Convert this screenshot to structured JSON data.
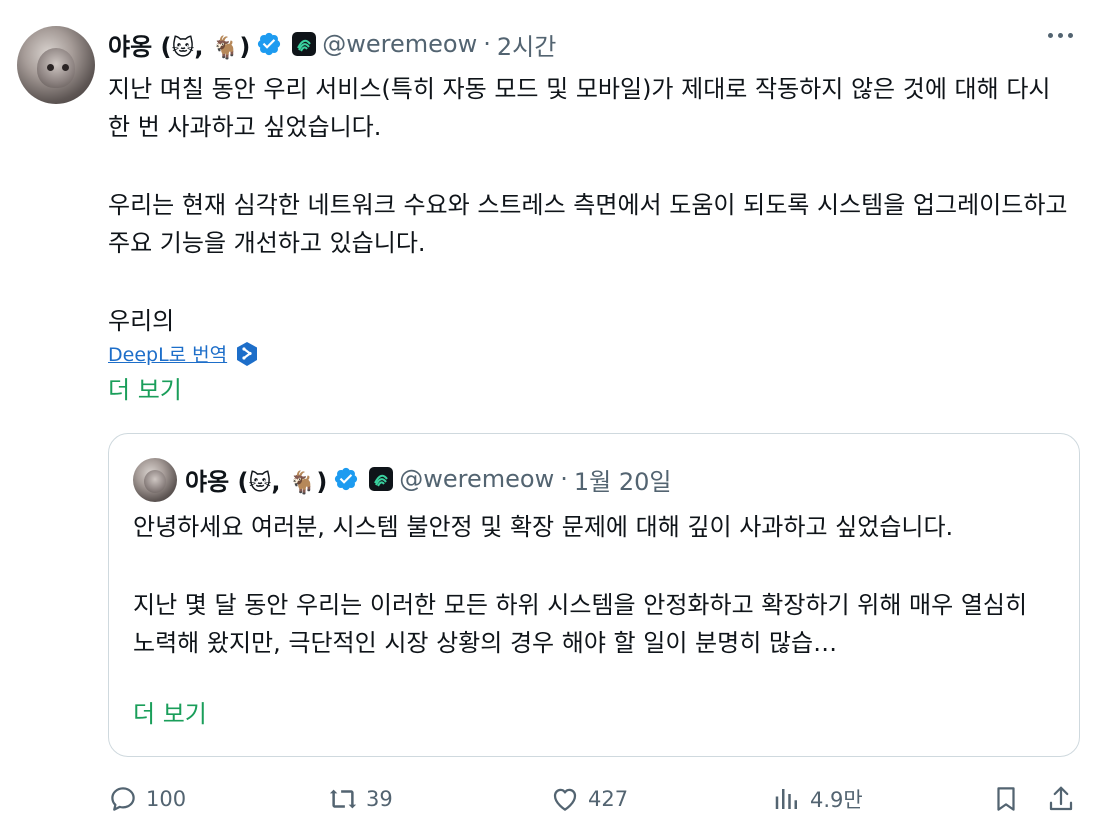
{
  "tweet": {
    "author_name": "야옹 (",
    "emoji_cat": "🐱",
    "comma": ",",
    "emoji_goat": "🐐",
    "paren_close": ")",
    "handle": "@weremeow",
    "separator": "·",
    "time": "2시간",
    "paragraphs": [
      "지난 며칠 동안 우리 서비스(특히 자동 모드 및 모바일)가 제대로 작동하지 않은 것에 대해 다시 한 번 사과하고 싶었습니다.",
      "우리는 현재 심각한 네트워크 수요와 스트레스 측면에서 도움이 되도록 시스템을 업그레이드하고 주요 기능을 개선하고 있습니다.",
      "우리의"
    ],
    "translate_label": "DeepL로 번역",
    "show_more": "더 보기"
  },
  "quoted": {
    "author_name": "야옹 (",
    "emoji_cat": "🐱",
    "comma": ",",
    "emoji_goat": "🐐",
    "paren_close": ")",
    "handle": "@weremeow",
    "separator": "·",
    "date": "1월 20일",
    "paragraphs": [
      "안녕하세요 여러분, 시스템 불안정 및 확장 문제에 대해 깊이 사과하고 싶었습니다.",
      "지난 몇 달 동안 우리는 이러한 모든 하위 시스템을 안정화하고 확장하기 위해 매우 열심히 노력해 왔지만, 극단적인 시장 상황의 경우 해야 할 일이 분명히 많습…"
    ],
    "show_more": "더 보기"
  },
  "actions": {
    "replies": "100",
    "retweets": "39",
    "likes": "427",
    "views": "4.9만"
  },
  "colors": {
    "verified": "#1d9bf0",
    "show_more": "#1a9e5a",
    "translate_link": "#1d6ec9",
    "muted": "#536471"
  }
}
